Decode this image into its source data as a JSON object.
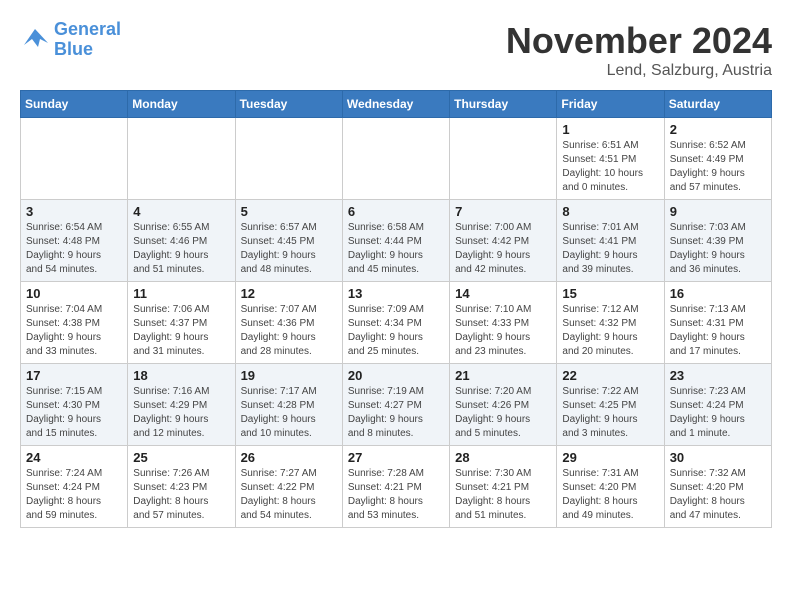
{
  "header": {
    "logo_line1": "General",
    "logo_line2": "Blue",
    "month_title": "November 2024",
    "location": "Lend, Salzburg, Austria"
  },
  "weekdays": [
    "Sunday",
    "Monday",
    "Tuesday",
    "Wednesday",
    "Thursday",
    "Friday",
    "Saturday"
  ],
  "weeks": [
    [
      {
        "day": "",
        "info": ""
      },
      {
        "day": "",
        "info": ""
      },
      {
        "day": "",
        "info": ""
      },
      {
        "day": "",
        "info": ""
      },
      {
        "day": "",
        "info": ""
      },
      {
        "day": "1",
        "info": "Sunrise: 6:51 AM\nSunset: 4:51 PM\nDaylight: 10 hours\nand 0 minutes."
      },
      {
        "day": "2",
        "info": "Sunrise: 6:52 AM\nSunset: 4:49 PM\nDaylight: 9 hours\nand 57 minutes."
      }
    ],
    [
      {
        "day": "3",
        "info": "Sunrise: 6:54 AM\nSunset: 4:48 PM\nDaylight: 9 hours\nand 54 minutes."
      },
      {
        "day": "4",
        "info": "Sunrise: 6:55 AM\nSunset: 4:46 PM\nDaylight: 9 hours\nand 51 minutes."
      },
      {
        "day": "5",
        "info": "Sunrise: 6:57 AM\nSunset: 4:45 PM\nDaylight: 9 hours\nand 48 minutes."
      },
      {
        "day": "6",
        "info": "Sunrise: 6:58 AM\nSunset: 4:44 PM\nDaylight: 9 hours\nand 45 minutes."
      },
      {
        "day": "7",
        "info": "Sunrise: 7:00 AM\nSunset: 4:42 PM\nDaylight: 9 hours\nand 42 minutes."
      },
      {
        "day": "8",
        "info": "Sunrise: 7:01 AM\nSunset: 4:41 PM\nDaylight: 9 hours\nand 39 minutes."
      },
      {
        "day": "9",
        "info": "Sunrise: 7:03 AM\nSunset: 4:39 PM\nDaylight: 9 hours\nand 36 minutes."
      }
    ],
    [
      {
        "day": "10",
        "info": "Sunrise: 7:04 AM\nSunset: 4:38 PM\nDaylight: 9 hours\nand 33 minutes."
      },
      {
        "day": "11",
        "info": "Sunrise: 7:06 AM\nSunset: 4:37 PM\nDaylight: 9 hours\nand 31 minutes."
      },
      {
        "day": "12",
        "info": "Sunrise: 7:07 AM\nSunset: 4:36 PM\nDaylight: 9 hours\nand 28 minutes."
      },
      {
        "day": "13",
        "info": "Sunrise: 7:09 AM\nSunset: 4:34 PM\nDaylight: 9 hours\nand 25 minutes."
      },
      {
        "day": "14",
        "info": "Sunrise: 7:10 AM\nSunset: 4:33 PM\nDaylight: 9 hours\nand 23 minutes."
      },
      {
        "day": "15",
        "info": "Sunrise: 7:12 AM\nSunset: 4:32 PM\nDaylight: 9 hours\nand 20 minutes."
      },
      {
        "day": "16",
        "info": "Sunrise: 7:13 AM\nSunset: 4:31 PM\nDaylight: 9 hours\nand 17 minutes."
      }
    ],
    [
      {
        "day": "17",
        "info": "Sunrise: 7:15 AM\nSunset: 4:30 PM\nDaylight: 9 hours\nand 15 minutes."
      },
      {
        "day": "18",
        "info": "Sunrise: 7:16 AM\nSunset: 4:29 PM\nDaylight: 9 hours\nand 12 minutes."
      },
      {
        "day": "19",
        "info": "Sunrise: 7:17 AM\nSunset: 4:28 PM\nDaylight: 9 hours\nand 10 minutes."
      },
      {
        "day": "20",
        "info": "Sunrise: 7:19 AM\nSunset: 4:27 PM\nDaylight: 9 hours\nand 8 minutes."
      },
      {
        "day": "21",
        "info": "Sunrise: 7:20 AM\nSunset: 4:26 PM\nDaylight: 9 hours\nand 5 minutes."
      },
      {
        "day": "22",
        "info": "Sunrise: 7:22 AM\nSunset: 4:25 PM\nDaylight: 9 hours\nand 3 minutes."
      },
      {
        "day": "23",
        "info": "Sunrise: 7:23 AM\nSunset: 4:24 PM\nDaylight: 9 hours\nand 1 minute."
      }
    ],
    [
      {
        "day": "24",
        "info": "Sunrise: 7:24 AM\nSunset: 4:24 PM\nDaylight: 8 hours\nand 59 minutes."
      },
      {
        "day": "25",
        "info": "Sunrise: 7:26 AM\nSunset: 4:23 PM\nDaylight: 8 hours\nand 57 minutes."
      },
      {
        "day": "26",
        "info": "Sunrise: 7:27 AM\nSunset: 4:22 PM\nDaylight: 8 hours\nand 54 minutes."
      },
      {
        "day": "27",
        "info": "Sunrise: 7:28 AM\nSunset: 4:21 PM\nDaylight: 8 hours\nand 53 minutes."
      },
      {
        "day": "28",
        "info": "Sunrise: 7:30 AM\nSunset: 4:21 PM\nDaylight: 8 hours\nand 51 minutes."
      },
      {
        "day": "29",
        "info": "Sunrise: 7:31 AM\nSunset: 4:20 PM\nDaylight: 8 hours\nand 49 minutes."
      },
      {
        "day": "30",
        "info": "Sunrise: 7:32 AM\nSunset: 4:20 PM\nDaylight: 8 hours\nand 47 minutes."
      }
    ]
  ]
}
